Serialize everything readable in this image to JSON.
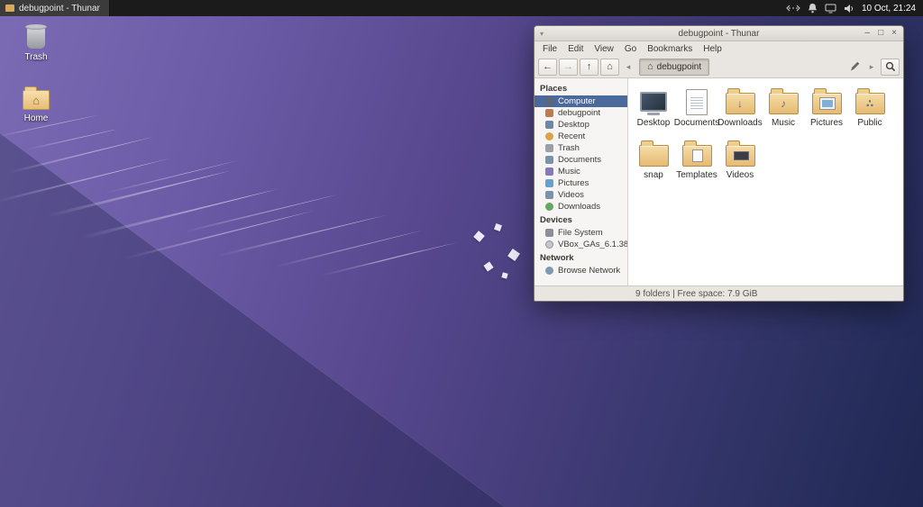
{
  "panel": {
    "window_button_label": "debugpoint - Thunar",
    "clock": "10 Oct, 21:24",
    "tray_icons": [
      "network-icon",
      "notifications-icon",
      "display-icon",
      "volume-icon"
    ]
  },
  "desktop": {
    "icons": [
      {
        "label": "Trash"
      },
      {
        "label": "Home"
      }
    ]
  },
  "window": {
    "title": "debugpoint - Thunar",
    "controls": {
      "minimize": "–",
      "maximize": "□",
      "close": "×"
    },
    "menus": [
      "File",
      "Edit",
      "View",
      "Go",
      "Bookmarks",
      "Help"
    ],
    "toolbar": {
      "back": "←",
      "forward": "→",
      "up": "↑",
      "home": "⌂",
      "scroll_left": "◂",
      "scroll_right": "▸",
      "path_home_glyph": "⌂",
      "path_button": "debugpoint"
    },
    "sidebar": {
      "sections": [
        {
          "header": "Places",
          "items": [
            {
              "label": "Computer",
              "icon": "computer",
              "selected": true
            },
            {
              "label": "debugpoint",
              "icon": "home"
            },
            {
              "label": "Desktop",
              "icon": "desktop"
            },
            {
              "label": "Recent",
              "icon": "recent"
            },
            {
              "label": "Trash",
              "icon": "trash"
            },
            {
              "label": "Documents",
              "icon": "documents"
            },
            {
              "label": "Music",
              "icon": "music"
            },
            {
              "label": "Pictures",
              "icon": "pictures"
            },
            {
              "label": "Videos",
              "icon": "videos"
            },
            {
              "label": "Downloads",
              "icon": "downloads"
            }
          ]
        },
        {
          "header": "Devices",
          "items": [
            {
              "label": "File System",
              "icon": "filesystem"
            },
            {
              "label": "VBox_GAs_6.1.38",
              "icon": "disc",
              "eject": true
            }
          ]
        },
        {
          "header": "Network",
          "items": [
            {
              "label": "Browse Network",
              "icon": "network"
            }
          ]
        }
      ]
    },
    "files": [
      {
        "label": "Desktop",
        "type": "desktop"
      },
      {
        "label": "Documents",
        "type": "documents"
      },
      {
        "label": "Downloads",
        "type": "downloads"
      },
      {
        "label": "Music",
        "type": "music"
      },
      {
        "label": "Pictures",
        "type": "pictures"
      },
      {
        "label": "Public",
        "type": "public"
      },
      {
        "label": "snap",
        "type": "plain"
      },
      {
        "label": "Templates",
        "type": "templates"
      },
      {
        "label": "Videos",
        "type": "videos"
      }
    ],
    "statusbar": "9 folders | Free space: 7.9 GiB"
  }
}
